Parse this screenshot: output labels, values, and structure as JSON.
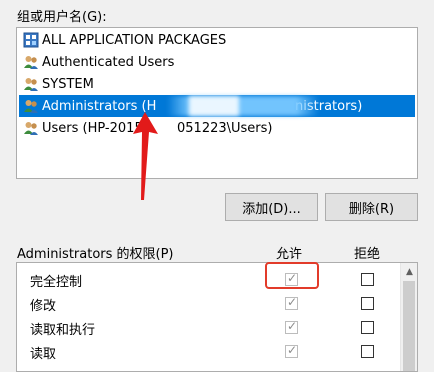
{
  "group_label": "组或用户名(G):",
  "users": [
    {
      "name": "ALL APPLICATION PACKAGES",
      "icon": "app-packages-icon"
    },
    {
      "name": "Authenticated Users",
      "icon": "users-group-icon"
    },
    {
      "name": "SYSTEM",
      "icon": "users-group-icon"
    },
    {
      "name": "Administrators (H",
      "suffix": "nistrators)",
      "icon": "users-group-icon",
      "selected": true
    },
    {
      "name": "Users (HP-2015",
      "suffix": "051223\\Users)",
      "icon": "users-group-icon"
    }
  ],
  "buttons": {
    "add": "添加(D)...",
    "remove": "删除(R)"
  },
  "permissions_title": "Administrators 的权限(P)",
  "col_allow": "允许",
  "col_deny": "拒绝",
  "permissions": [
    {
      "name": "完全控制",
      "allow": true,
      "deny": false
    },
    {
      "name": "修改",
      "allow": true,
      "deny": false
    },
    {
      "name": "读取和执行",
      "allow": true,
      "deny": false
    },
    {
      "name": "读取",
      "allow": true,
      "deny": false
    }
  ],
  "colors": {
    "selection": "#0078d7",
    "annotation": "#e23b2a"
  }
}
